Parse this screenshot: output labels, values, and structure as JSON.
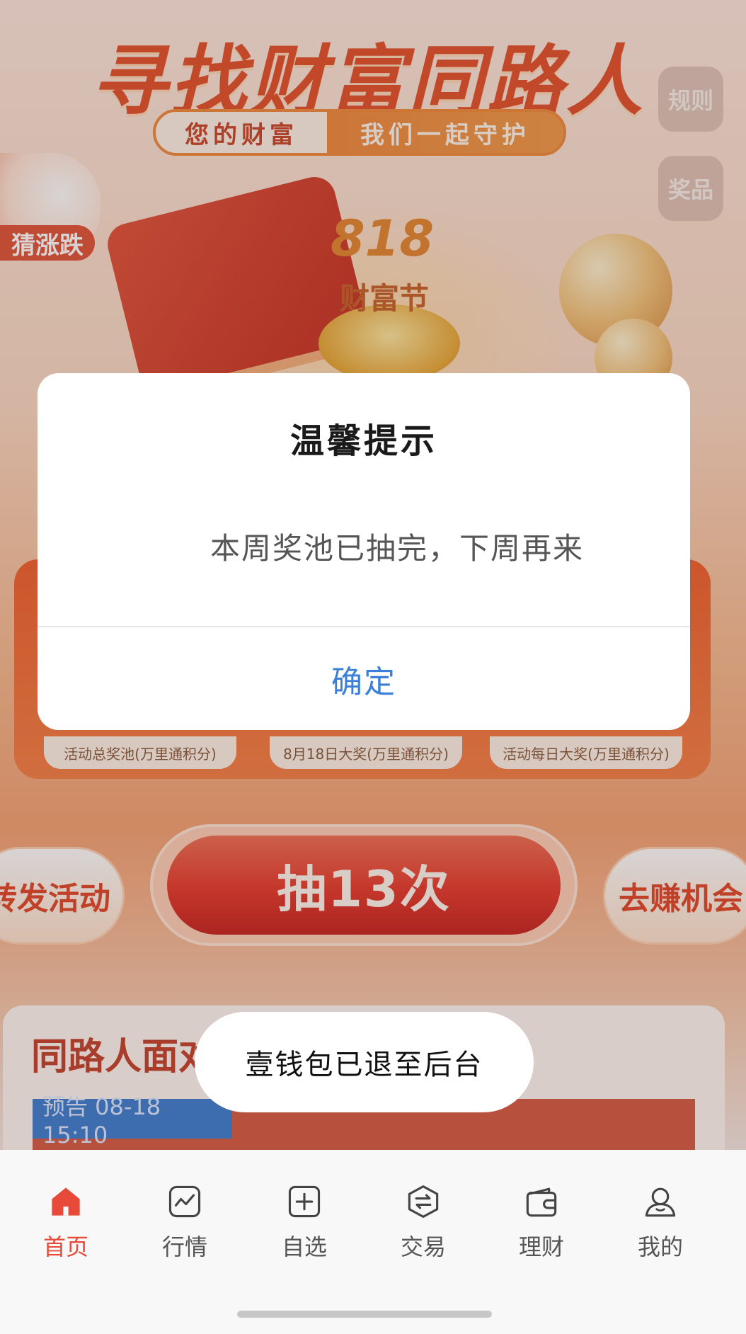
{
  "promo": {
    "headline": "寻找财富同路人",
    "slogan_left": "您的财富",
    "slogan_right": "我们一起守护",
    "side_buttons": [
      "规则",
      "奖品"
    ],
    "guess_label": "猜涨跌",
    "festival_number": "818",
    "festival_name": "财富节",
    "stats": [
      {
        "label": "活动总奖池(万里通积分)"
      },
      {
        "label": "8月18日大奖(万里通积分)"
      },
      {
        "label": "活动每日大奖(万里通积分)"
      }
    ],
    "share_label": "转发活动",
    "draw_label": "抽13次",
    "earn_label": "去赚机会",
    "companion_title": "同路人面对",
    "preview_tag": "预告 08-18 15:10"
  },
  "dialog": {
    "title": "温馨提示",
    "message": "本周奖池已抽完，下周再来",
    "confirm": "确定"
  },
  "toast": {
    "message": "壹钱包已退至后台"
  },
  "tabbar": {
    "active_color": "#e84a3a",
    "items": [
      {
        "label": "首页",
        "icon": "home-icon",
        "active": true
      },
      {
        "label": "行情",
        "icon": "chart-icon",
        "active": false
      },
      {
        "label": "自选",
        "icon": "add-icon",
        "active": false
      },
      {
        "label": "交易",
        "icon": "exchange-icon",
        "active": false
      },
      {
        "label": "理财",
        "icon": "wallet-icon",
        "active": false
      },
      {
        "label": "我的",
        "icon": "user-icon",
        "active": false
      }
    ]
  }
}
